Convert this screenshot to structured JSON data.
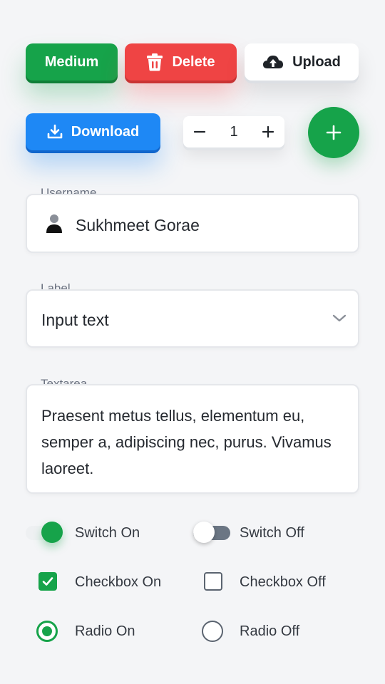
{
  "buttons": {
    "medium": "Medium",
    "delete": "Delete",
    "upload": "Upload",
    "download": "Download"
  },
  "stepper": {
    "value": "1"
  },
  "fab": {
    "icon": "plus-icon"
  },
  "username_field": {
    "label": "Username",
    "value": "Sukhmeet Gorae",
    "icon": "user-icon"
  },
  "select_field": {
    "label": "Label",
    "value": "Input text",
    "icon": "chevron-down-icon"
  },
  "textarea_field": {
    "label": "Textarea",
    "value": "Praesent metus tellus, elementum eu, semper a, adipiscing nec, purus. Vivamus laoreet."
  },
  "controls": {
    "switch_on": {
      "label": "Switch On",
      "checked": true
    },
    "switch_off": {
      "label": "Switch Off",
      "checked": false
    },
    "checkbox_on": {
      "label": "Checkbox On",
      "checked": true
    },
    "checkbox_off": {
      "label": "Checkbox Off",
      "checked": false
    },
    "radio_on": {
      "label": "Radio On",
      "checked": true
    },
    "radio_off": {
      "label": "Radio Off",
      "checked": false
    }
  },
  "colors": {
    "green": "#16a34a",
    "red": "#ef4444",
    "blue": "#1e88f5",
    "background": "#f4f5f7"
  }
}
